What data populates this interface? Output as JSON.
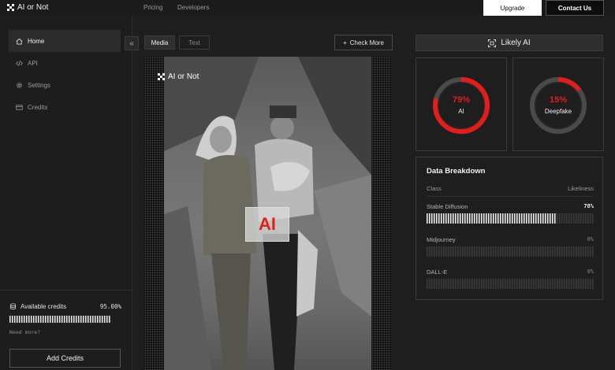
{
  "header": {
    "logo": "AI or Not",
    "nav": [
      "Pricing",
      "Developers"
    ],
    "upgrade_label": "Upgrade",
    "contact_label": "Contact Us"
  },
  "sidebar": {
    "items": [
      {
        "label": "Home",
        "icon": "home-icon"
      },
      {
        "label": "API",
        "icon": "code-icon"
      },
      {
        "label": "Settings",
        "icon": "gear-icon"
      },
      {
        "label": "Credits",
        "icon": "card-icon"
      }
    ],
    "credits_label": "Available credits",
    "credits_value": "95.00%",
    "credits_fraction": 0.95,
    "need_more": "Need more?",
    "add_credits": "Add Credits"
  },
  "main": {
    "tabs": [
      "Media",
      "Text"
    ],
    "check_more": "Check More",
    "media_logo": "AI or Not",
    "stamp_text": "AI"
  },
  "result": {
    "verdict": "Likely AI",
    "gauges": [
      {
        "pct": "79%",
        "value": 0.79,
        "name": "AI"
      },
      {
        "pct": "15%",
        "value": 0.15,
        "name": "Deepfake"
      }
    ],
    "accent": "#e31c1c"
  },
  "breakdown": {
    "title": "Data Breakdown",
    "col_class": "Class",
    "col_likeliness": "Likeliness",
    "rows": [
      {
        "name": "Stable Diffusion",
        "value": "78%",
        "fraction": 0.78
      },
      {
        "name": "Midjourney",
        "value": "0%",
        "fraction": 0
      },
      {
        "name": "DALL-E",
        "value": "0%",
        "fraction": 0
      }
    ]
  }
}
